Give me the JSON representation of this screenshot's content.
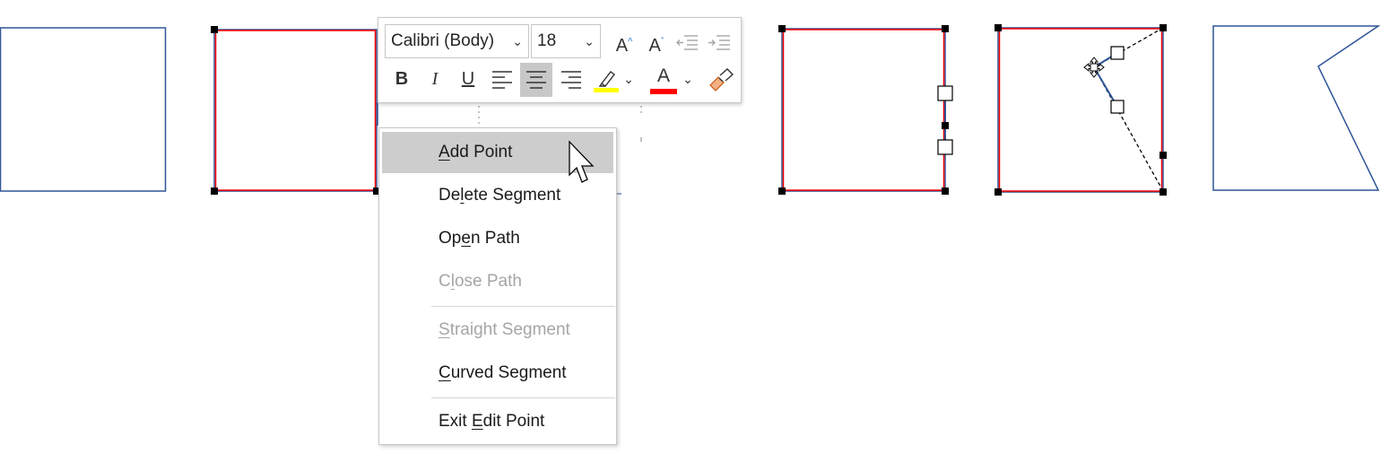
{
  "toolbar": {
    "font_name": "Calibri (Body)",
    "font_size": "18",
    "grow_font_icon": "grow-font-icon",
    "shrink_font_icon": "shrink-font-icon",
    "decrease_indent_icon": "decrease-indent-icon",
    "increase_indent_icon": "increase-indent-icon",
    "bold_label": "B",
    "italic_label": "I",
    "underline_label": "U",
    "font_color_label": "A",
    "grow_font_label": "A",
    "shrink_font_label": "A",
    "highlight_color": "#ffff00",
    "font_color": "#ff0000"
  },
  "context_menu": {
    "items": [
      {
        "pre": "",
        "key": "A",
        "post": "dd Point",
        "state": "hover"
      },
      {
        "pre": "De",
        "key": "l",
        "post": "ete Segment",
        "state": "enabled"
      },
      {
        "pre": "Op",
        "key": "e",
        "post": "n Path",
        "state": "enabled"
      },
      {
        "pre": "C",
        "key": "l",
        "post": "ose Path",
        "state": "disabled"
      },
      {
        "pre": "",
        "key": "S",
        "post": "traight Segment",
        "state": "disabled"
      },
      {
        "pre": "",
        "key": "C",
        "post": "urved Segment",
        "state": "enabled"
      },
      {
        "pre": "Exit ",
        "key": "E",
        "post": "dit Point",
        "state": "enabled"
      }
    ]
  },
  "colors": {
    "shape_outline": "#2f5597",
    "edit_path_red": "#ff0000",
    "handle_black": "#000000",
    "menu_hover": "#cdcdcd"
  }
}
